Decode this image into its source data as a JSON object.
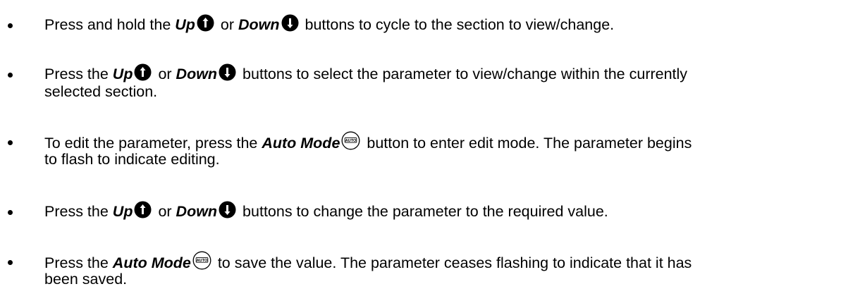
{
  "items": [
    {
      "pre": "Press and hold the ",
      "b1": "Up",
      "mid": " or ",
      "b2": "Down",
      "post": " buttons to cycle to the section to view/change."
    },
    {
      "pre": "Press the ",
      "b1": "Up",
      "mid": " or ",
      "b2": "Down",
      "post": " buttons to select the parameter to view/change within the currently",
      "line2": "selected section."
    },
    {
      "pre": "To edit the parameter, press the ",
      "b1": "Auto Mode",
      "post": " button to enter edit mode. The parameter begins",
      "line2": "to flash to indicate editing."
    },
    {
      "pre": "Press the ",
      "b1": "Up",
      "mid": " or ",
      "b2": "Down",
      "post": " buttons to change the parameter to the required value."
    },
    {
      "pre": "Press the ",
      "b1": "Auto Mode",
      "post": " to save the value. The parameter ceases flashing to indicate that it has",
      "line2": "been saved."
    }
  ],
  "auto_icon_label": "AUTO",
  "icons": {
    "up": "up-arrow-button-icon",
    "down": "down-arrow-button-icon",
    "auto": "auto-mode-button-icon"
  },
  "colors": {
    "text": "#000000",
    "button_fill": "#000000",
    "button_glyph": "#ffffff"
  }
}
